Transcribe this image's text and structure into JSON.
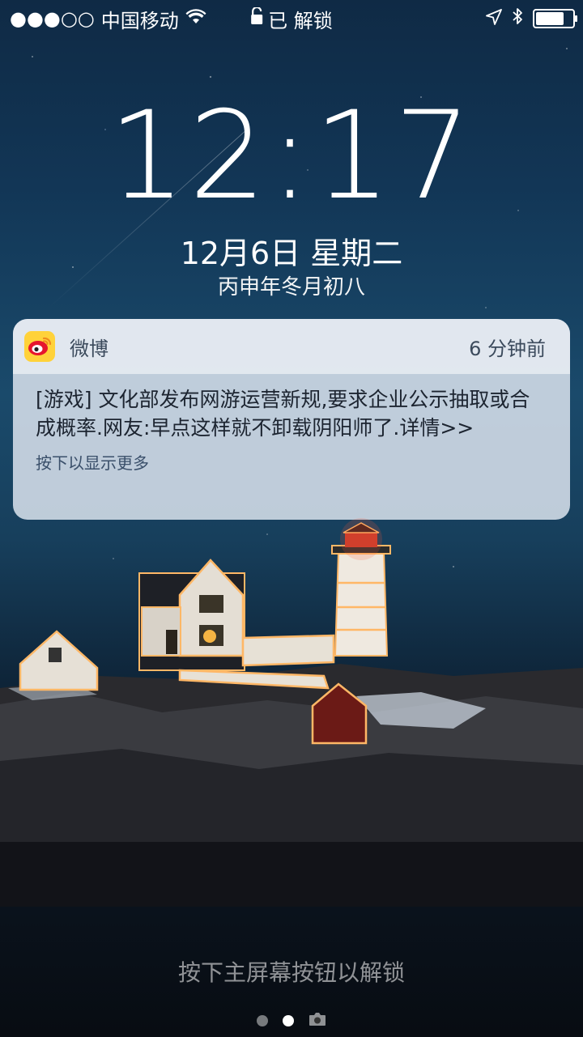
{
  "status_bar": {
    "signal": "●●●○○",
    "carrier": "中国移动",
    "lock_label": "已 解锁",
    "icons": [
      "wifi-icon",
      "location-icon",
      "bluetooth-icon",
      "battery-icon"
    ],
    "battery_level": 0.85
  },
  "lock_screen": {
    "time": "12:17",
    "date": "12月6日 星期二",
    "lunar_date": "丙申年冬月初八"
  },
  "notification": {
    "app_icon": "weibo-icon",
    "app_name": "微博",
    "time_ago": "6 分钟前",
    "message": "[游戏] 文化部发布网游运营新规,要求企业公示抽取或合成概率.网友:早点这样就不卸载阴阳师了.详情>>",
    "hint": "按下以显示更多"
  },
  "bottom": {
    "unlock_hint": "按下主屏幕按钮以解锁",
    "pages": [
      "page-dot",
      "page-dot-active",
      "camera-icon"
    ]
  },
  "colors": {
    "sky_top": "#0f2a45",
    "notification_bg": "#d6dfeb",
    "weibo_yellow": "#ffd23a",
    "weibo_red": "#e6162d"
  }
}
